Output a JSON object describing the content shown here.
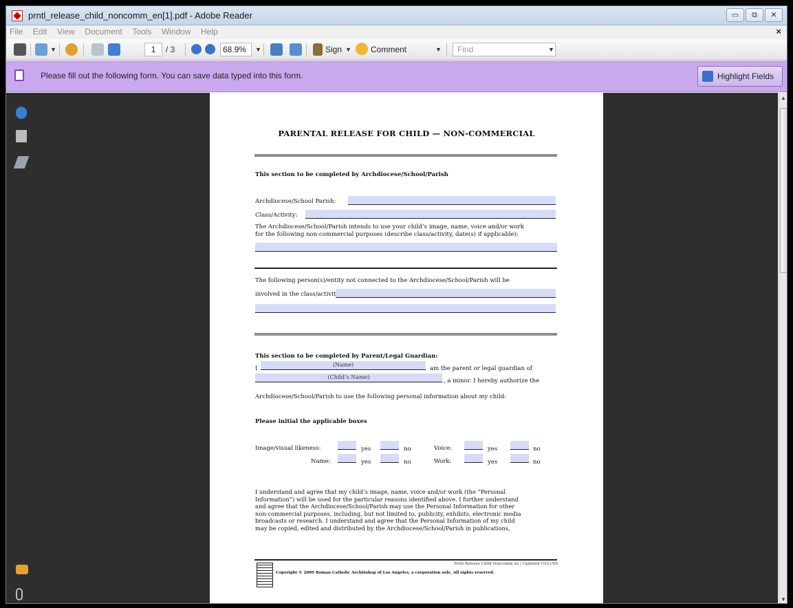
{
  "window": {
    "title": "prntl_release_child_noncomm_en[1].pdf - Adobe Reader",
    "controls": [
      "▭",
      "⧉",
      "✕"
    ]
  },
  "menu": {
    "items": [
      "File",
      "Edit",
      "View",
      "Document",
      "Tools",
      "Window",
      "Help"
    ],
    "close_glyph": "×"
  },
  "toolbar": {
    "page_current": "1",
    "page_total": "/ 3",
    "zoom": "68.9%",
    "sign_label": "Sign",
    "comment_label": "Comment",
    "find_placeholder": "Find"
  },
  "formbar": {
    "message": "Please fill out the following form. You can save data typed into this form.",
    "highlight_label": "Highlight Fields"
  },
  "document": {
    "title": "PARENTAL RELEASE FOR CHILD — NON-COMMERCIAL",
    "section1_heading": "This section to be completed by Archdiocese/School/Parish",
    "label_parish": "Archdiocese/School Parish:",
    "label_class": "Class/Activity:",
    "intends_line1": "The Archdiocese/School/Parish intends to use your child’s image, name, voice and/or work",
    "intends_line2": "for the following non-commercial purposes (describe class/activity, date(s) if applicable):",
    "persons_line1": "The following person(s)/entity not connected to the Archdiocese/School/Parish will be",
    "persons_line2": "involved in the class/activity:",
    "section2_heading": "This section to be completed by Parent/Legal Guardian:",
    "i_label": "I",
    "name_hint": "(Name)",
    "parent_text": "am the parent or legal guardian of",
    "child_hint": "(Child’s Name)",
    "minor_text": ", a minor.  I hereby authorize the",
    "authorize_line": "Archdiocese/School/Parish to use the following personal information about my child:",
    "initial_heading": "Please initial the applicable boxes",
    "label_image": "Image/visual likeness:",
    "label_name": "Name:",
    "label_voice": "Voice:",
    "label_work": "Work:",
    "yes": "yes",
    "no": "no",
    "paragraph": [
      "I understand and agree that my child’s image, name, voice and/or work (the “Personal",
      "Information”) will be used for the particular reasons identified above.  I further understand",
      "and agree that the Archdiocese/School/Parish may use the Personal Information for other",
      "non-commercial purposes, including, but not limited to, publicity, exhibits, electronic media",
      "broadcasts or research.  I understand and agree that the Personal Information of my child",
      "may be copied, edited and distributed by the Archdiocese/School/Parish in publications,"
    ],
    "footer_right": "Prntl Release Child Noncomm en  |  Updated 10/21/09",
    "footer_copyright": "Copyright © 2009 Roman Catholic Archbishop of Los Angeles, a corporation sole. All rights reserved."
  }
}
